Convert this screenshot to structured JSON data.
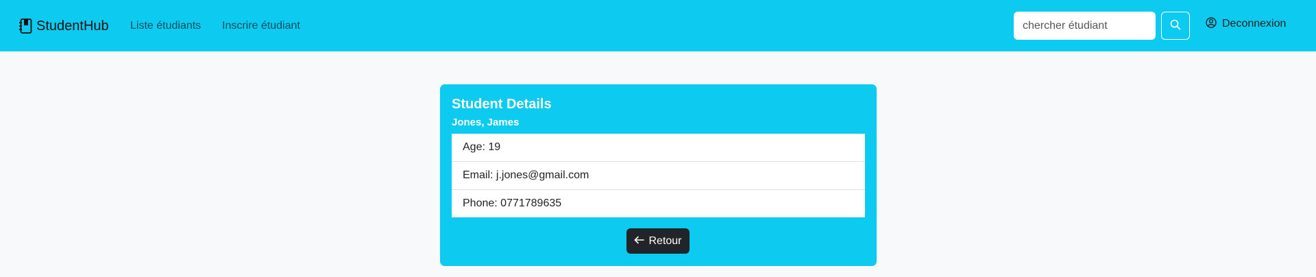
{
  "navbar": {
    "brand": "StudentHub",
    "brand_icon": "journal-bookmark-icon",
    "links": [
      "Liste étudiants",
      "Inscrire étudiant"
    ],
    "search": {
      "placeholder": "chercher étudiant",
      "value": ""
    },
    "search_button_icon": "search-icon",
    "logout_label": "Deconnexion",
    "logout_icon": "person-circle-icon"
  },
  "card": {
    "title": "Student Details",
    "subtitle": "Jones, James",
    "items": [
      "Age: 19",
      "Email: j.jones@gmail.com",
      "Phone: 0771789635"
    ],
    "back_button": "Retour",
    "back_icon": "arrow-left-icon"
  },
  "colors": {
    "navbar": "#0dcaf0",
    "card": "#0dcaf0",
    "button": "#212529",
    "background": "#f8f9fa"
  }
}
